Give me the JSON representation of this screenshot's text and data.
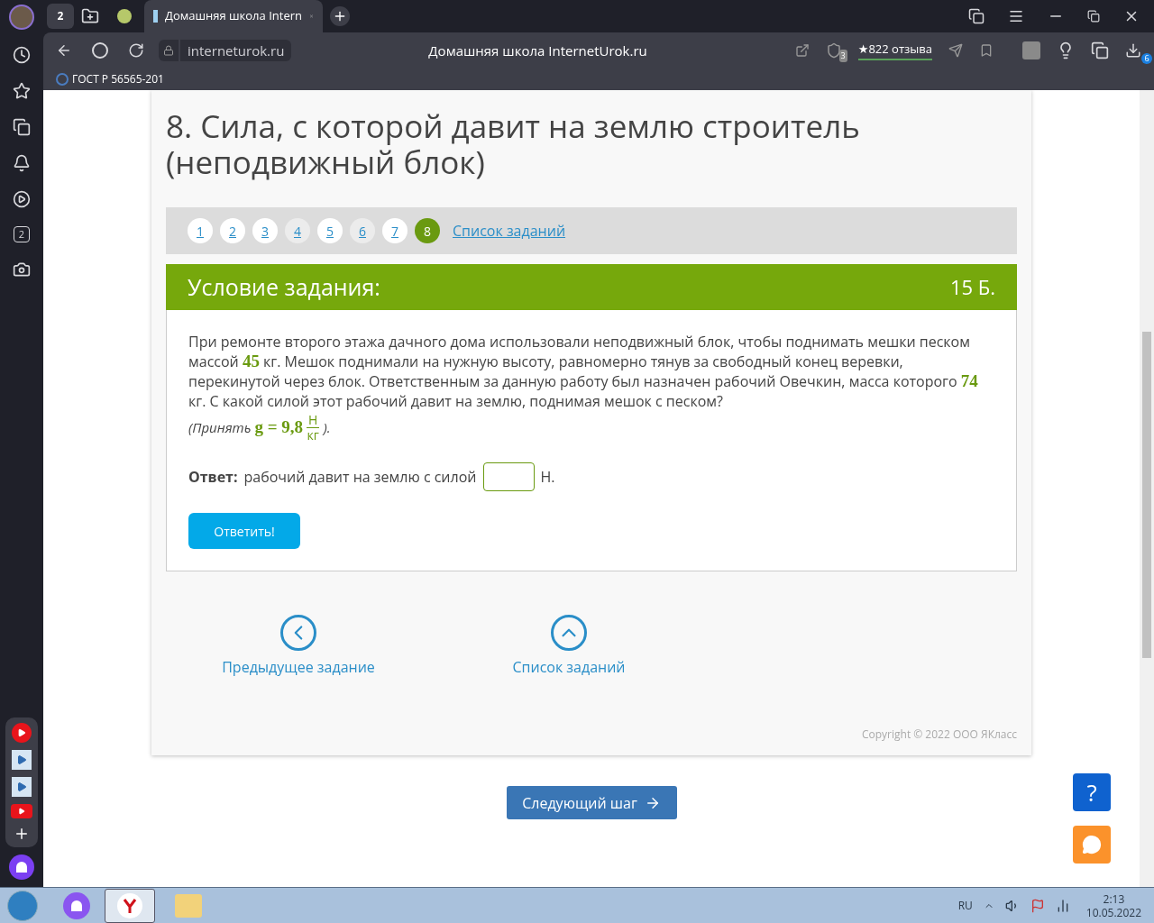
{
  "browser": {
    "tab_count": "2",
    "active_tab_title": "Домашняя школа Intern",
    "address": "interneturok.ru",
    "page_title": "Домашняя школа InternetUrok.ru",
    "shield_count": "3",
    "reviews": "★822 отзыва",
    "downloads_count": "6",
    "bookmark": "ГОСТ Р 56565-201",
    "sidebar_badge": "2"
  },
  "page": {
    "title": "8. Сила, с которой давит на землю строитель (неподвижный блок)",
    "steps": [
      {
        "label": "1",
        "selected": false,
        "dimmed": false
      },
      {
        "label": "2",
        "selected": false,
        "dimmed": false
      },
      {
        "label": "3",
        "selected": false,
        "dimmed": false
      },
      {
        "label": "4",
        "selected": false,
        "dimmed": true
      },
      {
        "label": "5",
        "selected": false,
        "dimmed": false
      },
      {
        "label": "6",
        "selected": false,
        "dimmed": true
      },
      {
        "label": "7",
        "selected": false,
        "dimmed": false
      },
      {
        "label": "8",
        "selected": true,
        "dimmed": false
      }
    ],
    "task_list_link": "Список заданий",
    "header": {
      "title": "Условие задания:",
      "points": "15 Б."
    },
    "question": "При ремонте второго этажа дачного дома использовали неподвижный блок, чтобы поднимать мешки песком массой **45** кг. Мешок поднимали на нужную высоту, равномерно тянув за свободный конец веревки, перекинутой через блок. Ответственным за данную работу был назначен рабочий Овечкин, масса которого **74** кг. С какой силой этот рабочий давит на землю, поднимая мешок с песком?",
    "hint": {
      "prefix": "(Принять",
      "formula": "g = 9,8",
      "numerator": "Н",
      "denominator": "кг",
      "suffix": ")."
    },
    "answer": {
      "label": "Ответ:",
      "text": "рабочий давит на землю с силой",
      "unit": "Н."
    },
    "submit": "Ответить!",
    "prev": "Предыдущее задание",
    "list": "Список заданий",
    "copyright": "Copyright © 2022 ООО ЯКласс",
    "next": "Следующий шаг",
    "help": "?"
  },
  "taskbar": {
    "language": "RU",
    "time": "2:13",
    "date": "10.05.2022"
  }
}
